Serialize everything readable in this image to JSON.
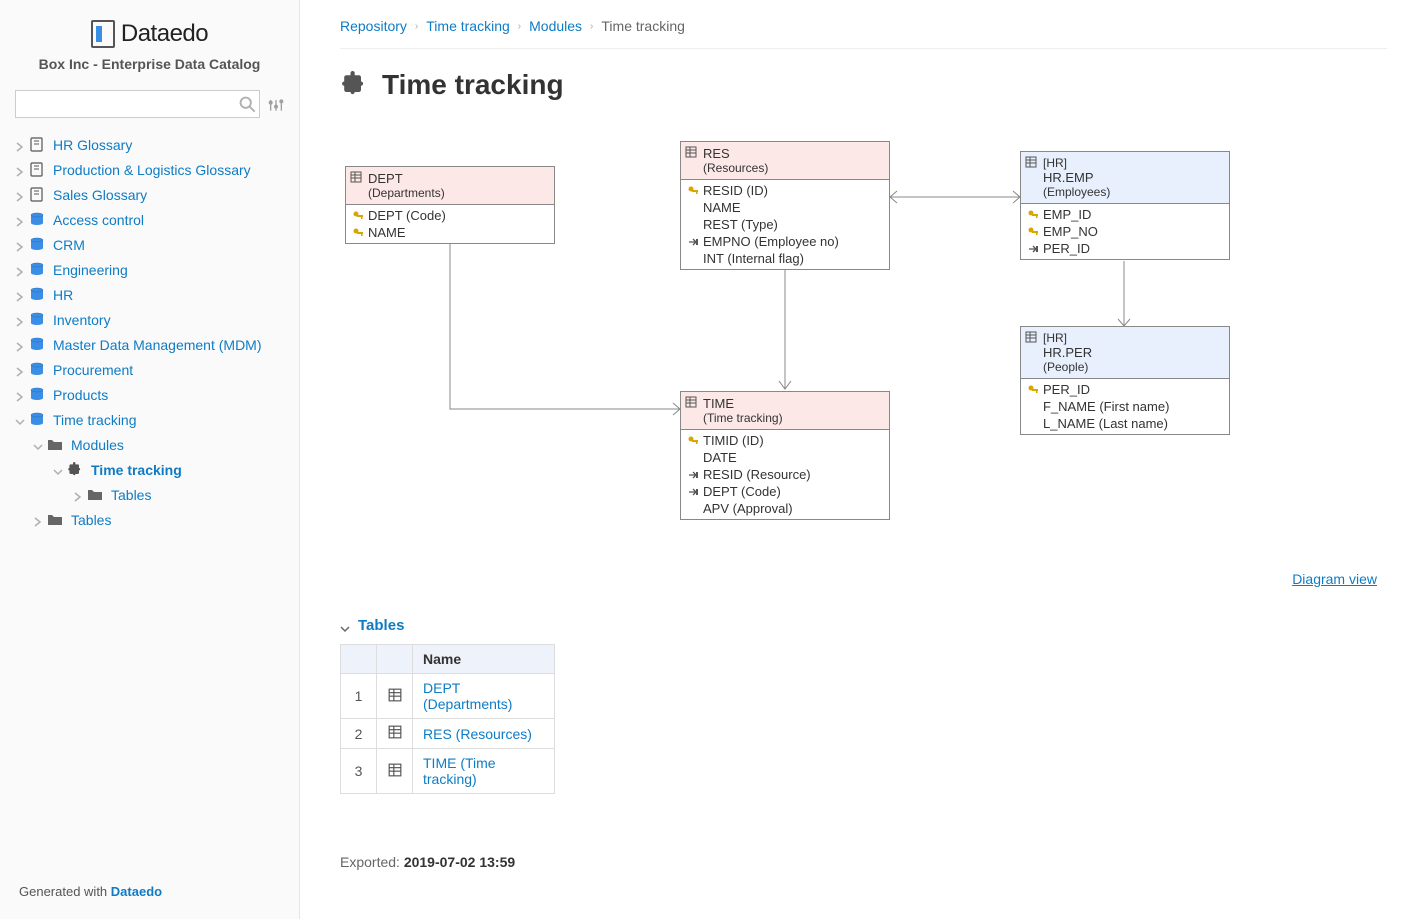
{
  "brand": {
    "name": "Dataedo",
    "subtitle": "Box Inc - Enterprise Data Catalog"
  },
  "search": {
    "placeholder": ""
  },
  "sidebar": {
    "items": [
      {
        "label": "HR Glossary",
        "icon": "book"
      },
      {
        "label": "Production & Logistics Glossary",
        "icon": "book"
      },
      {
        "label": "Sales Glossary",
        "icon": "book"
      },
      {
        "label": "Access control",
        "icon": "db"
      },
      {
        "label": "CRM",
        "icon": "db"
      },
      {
        "label": "Engineering",
        "icon": "db"
      },
      {
        "label": "HR",
        "icon": "db"
      },
      {
        "label": "Inventory",
        "icon": "db"
      },
      {
        "label": "Master Data Management (MDM)",
        "icon": "db"
      },
      {
        "label": "Procurement",
        "icon": "db"
      },
      {
        "label": "Products",
        "icon": "db"
      },
      {
        "label": "Time tracking",
        "icon": "db",
        "expanded": true
      }
    ],
    "timeTracking": {
      "modules": {
        "label": "Modules"
      },
      "timeTrackingModule": {
        "label": "Time tracking"
      },
      "tablesLeaf": {
        "label": "Tables"
      },
      "tablesNode": {
        "label": "Tables"
      }
    }
  },
  "footer": {
    "prefix": "Generated with ",
    "brand": "Dataedo"
  },
  "breadcrumb": {
    "items": [
      "Repository",
      "Time tracking",
      "Modules"
    ],
    "current": "Time tracking"
  },
  "page": {
    "title": "Time tracking",
    "diagramLink": "Diagram view"
  },
  "entities": {
    "dept": {
      "name": "DEPT",
      "subtitle": "(Departments)",
      "cols": [
        {
          "icon": "key",
          "label": "DEPT (Code)"
        },
        {
          "icon": "key",
          "label": "NAME"
        }
      ]
    },
    "res": {
      "name": "RES",
      "subtitle": "(Resources)",
      "cols": [
        {
          "icon": "key",
          "label": "RESID (ID)"
        },
        {
          "icon": "",
          "label": "NAME"
        },
        {
          "icon": "",
          "label": "REST (Type)"
        },
        {
          "icon": "fk",
          "label": "EMPNO (Employee no)"
        },
        {
          "icon": "",
          "label": "INT (Internal flag)"
        }
      ]
    },
    "hremp": {
      "schema": "[HR]",
      "name": "HR.EMP",
      "subtitle": "(Employees)",
      "cols": [
        {
          "icon": "key",
          "label": "EMP_ID"
        },
        {
          "icon": "key",
          "label": "EMP_NO"
        },
        {
          "icon": "fk",
          "label": "PER_ID"
        }
      ]
    },
    "hrper": {
      "schema": "[HR]",
      "name": "HR.PER",
      "subtitle": "(People)",
      "cols": [
        {
          "icon": "key",
          "label": "PER_ID"
        },
        {
          "icon": "",
          "label": "F_NAME (First name)"
        },
        {
          "icon": "",
          "label": "L_NAME (Last name)"
        }
      ]
    },
    "time": {
      "name": "TIME",
      "subtitle": "(Time tracking)",
      "cols": [
        {
          "icon": "key",
          "label": "TIMID (ID)"
        },
        {
          "icon": "",
          "label": "DATE"
        },
        {
          "icon": "fk",
          "label": "RESID (Resource)"
        },
        {
          "icon": "fk",
          "label": "DEPT (Code)"
        },
        {
          "icon": "",
          "label": "APV (Approval)"
        }
      ]
    }
  },
  "tablesSection": {
    "title": "Tables",
    "header": "Name",
    "rows": [
      {
        "idx": "1",
        "label": "DEPT (Departments)"
      },
      {
        "idx": "2",
        "label": "RES (Resources)"
      },
      {
        "idx": "3",
        "label": "TIME (Time tracking)"
      }
    ]
  },
  "export": {
    "prefix": "Exported: ",
    "timestamp": "2019-07-02 13:59"
  }
}
